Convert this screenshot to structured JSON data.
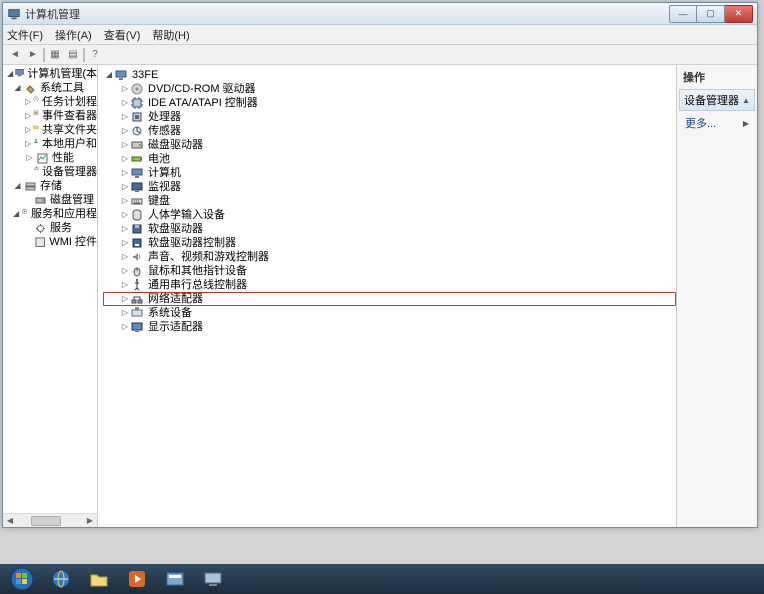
{
  "window": {
    "title": "计算机管理"
  },
  "menubar": {
    "file": "文件(F)",
    "action": "操作(A)",
    "view": "查看(V)",
    "help": "帮助(H)"
  },
  "leftTree": {
    "root": "计算机管理(本",
    "systemTools": "系统工具",
    "systemToolsChildren": {
      "taskScheduler": "任务计划程",
      "eventViewer": "事件查看器",
      "sharedFolders": "共享文件夹",
      "localUsers": "本地用户和",
      "performance": "性能",
      "deviceManager": "设备管理器"
    },
    "storage": "存储",
    "storageChildren": {
      "diskMgmt": "磁盘管理"
    },
    "servicesApps": "服务和应用程",
    "servicesAppsChildren": {
      "services": "服务",
      "wmi": "WMI 控件"
    }
  },
  "devTree": {
    "root": "33FE",
    "items": [
      {
        "label": "DVD/CD-ROM 驱动器",
        "icon": "disc"
      },
      {
        "label": "IDE ATA/ATAPI 控制器",
        "icon": "chip"
      },
      {
        "label": "处理器",
        "icon": "cpu"
      },
      {
        "label": "传感器",
        "icon": "sensor"
      },
      {
        "label": "磁盘驱动器",
        "icon": "disk"
      },
      {
        "label": "电池",
        "icon": "battery"
      },
      {
        "label": "计算机",
        "icon": "computer"
      },
      {
        "label": "监视器",
        "icon": "monitor"
      },
      {
        "label": "键盘",
        "icon": "keyboard"
      },
      {
        "label": "人体学输入设备",
        "icon": "hid"
      },
      {
        "label": "软盘驱动器",
        "icon": "floppy"
      },
      {
        "label": "软盘驱动器控制器",
        "icon": "floppyctrl"
      },
      {
        "label": "声音、视频和游戏控制器",
        "icon": "sound"
      },
      {
        "label": "鼠标和其他指针设备",
        "icon": "mouse"
      },
      {
        "label": "通用串行总线控制器",
        "icon": "usb"
      },
      {
        "label": "网络适配器",
        "icon": "network",
        "highlight": true
      },
      {
        "label": "系统设备",
        "icon": "system"
      },
      {
        "label": "显示适配器",
        "icon": "display"
      }
    ]
  },
  "actions": {
    "header": "操作",
    "section": "设备管理器",
    "more": "更多..."
  }
}
